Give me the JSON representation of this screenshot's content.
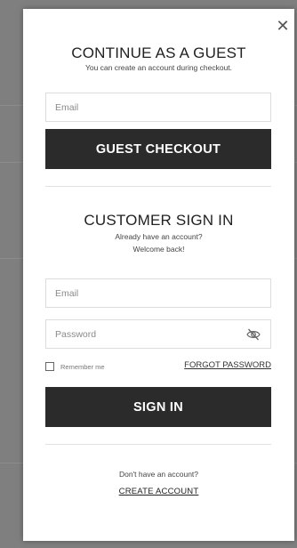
{
  "colors": {
    "backdrop": "#7f7f7f",
    "button": "#2b2b2b",
    "text": "#222222"
  },
  "modal": {
    "close_icon": "close-icon"
  },
  "guest": {
    "title": "CONTINUE AS A GUEST",
    "subtitle": "You can create an account during checkout.",
    "email_placeholder": "Email",
    "button_label": "GUEST CHECKOUT"
  },
  "signin": {
    "title": "CUSTOMER SIGN IN",
    "line1": "Already have an account?",
    "line2": "Welcome back!",
    "email_placeholder": "Email",
    "password_placeholder": "Password",
    "password_toggle_icon": "eye-slash-icon",
    "remember_label": "Remember me",
    "forgot_label": "FORGOT PASSWORD",
    "button_label": "SIGN IN"
  },
  "footer": {
    "prompt": "Don't have an account?",
    "create_label": "CREATE ACCOUNT"
  }
}
